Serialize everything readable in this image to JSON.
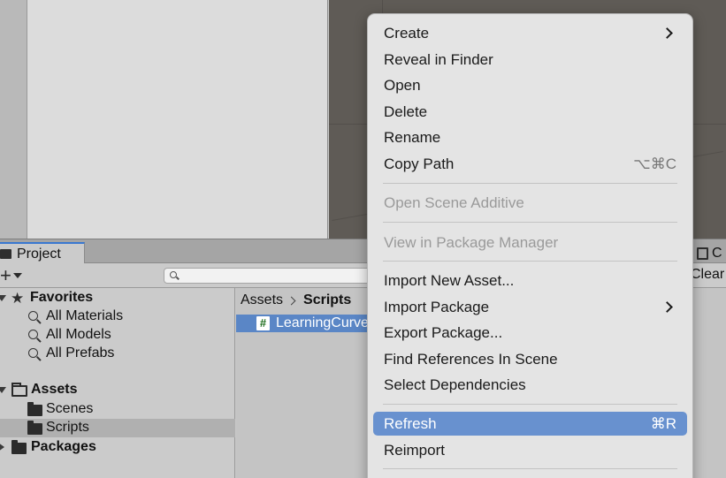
{
  "tabs": {
    "project_label": "Project",
    "console_label": "C"
  },
  "toolbar": {
    "add_symbol": "+",
    "search_placeholder": "",
    "clear_label": "Clear"
  },
  "tree": {
    "favorites_label": "Favorites",
    "favorites_items": [
      "All Materials",
      "All Models",
      "All Prefabs"
    ],
    "assets_label": "Assets",
    "assets_children": [
      "Scenes",
      "Scripts"
    ],
    "selected_folder": "Scripts",
    "packages_label": "Packages"
  },
  "assets_pane": {
    "breadcrumb": [
      "Assets",
      "Scripts"
    ],
    "item_icon_glyph": "#",
    "item_label": "LearningCurve"
  },
  "context_menu": {
    "items": [
      {
        "label": "Create",
        "submenu": true
      },
      {
        "label": "Reveal in Finder"
      },
      {
        "label": "Open"
      },
      {
        "label": "Delete"
      },
      {
        "label": "Rename"
      },
      {
        "label": "Copy Path",
        "shortcut": "⌥⌘C"
      },
      {
        "label": "Open Scene Additive",
        "disabled": true
      },
      {
        "label": "View in Package Manager",
        "disabled": true
      },
      {
        "label": "Import New Asset..."
      },
      {
        "label": "Import Package",
        "submenu": true
      },
      {
        "label": "Export Package..."
      },
      {
        "label": "Find References In Scene"
      },
      {
        "label": "Select Dependencies"
      },
      {
        "label": "Refresh",
        "shortcut": "⌘R",
        "highlighted": true
      },
      {
        "label": "Reimport"
      }
    ]
  },
  "colors": {
    "highlight": "#6891cf",
    "selection": "#5a86c6",
    "tab_accent": "#3a78d0"
  }
}
